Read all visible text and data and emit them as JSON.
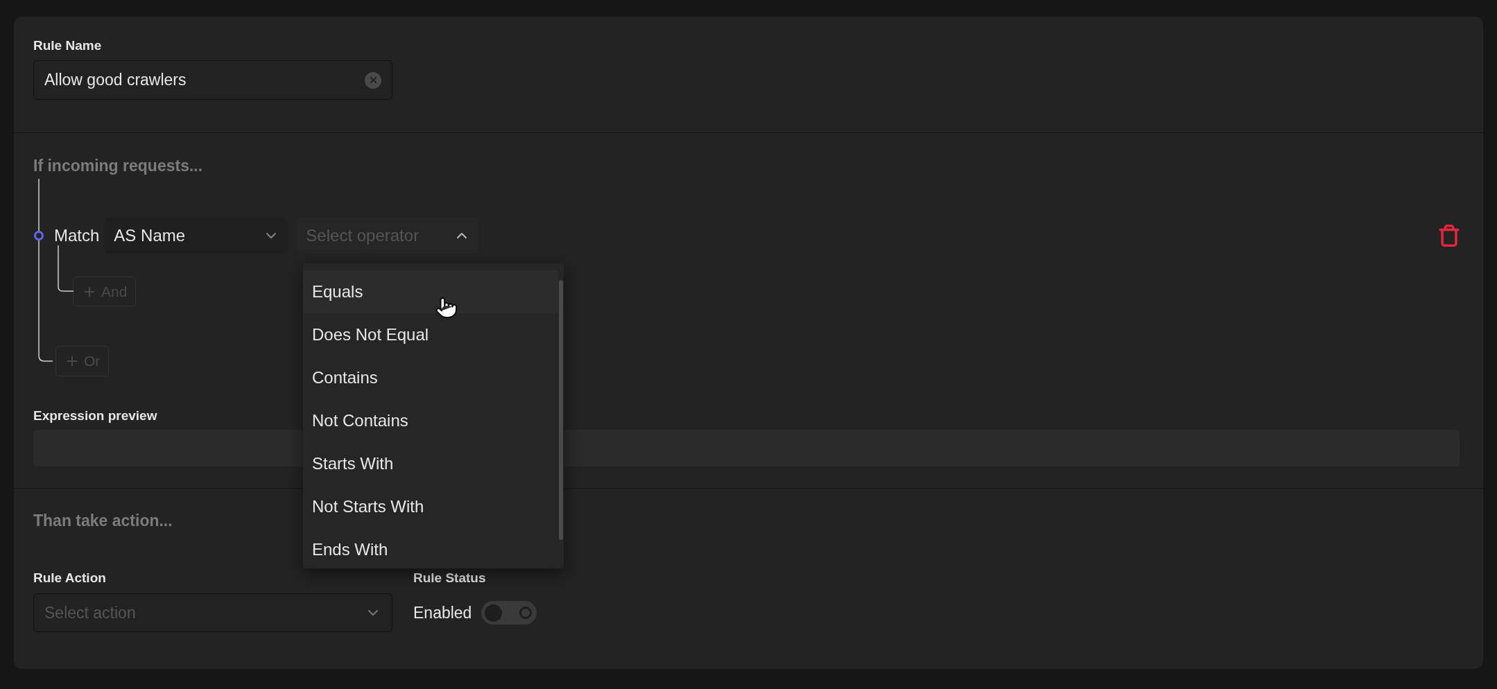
{
  "rule_name": {
    "label": "Rule Name",
    "value": "Allow good crawlers"
  },
  "conditions": {
    "heading": "If incoming requests...",
    "match_label": "Match",
    "field_select": {
      "value": "AS Name"
    },
    "operator_select": {
      "placeholder": "Select operator",
      "expanded": true
    },
    "and_button": "And",
    "or_button": "Or"
  },
  "operator_menu": {
    "items": [
      {
        "label": "Equals",
        "highlighted": true
      },
      {
        "label": "Does Not Equal",
        "highlighted": false
      },
      {
        "label": "Contains",
        "highlighted": false
      },
      {
        "label": "Not Contains",
        "highlighted": false
      },
      {
        "label": "Starts With",
        "highlighted": false
      },
      {
        "label": "Not Starts With",
        "highlighted": false
      },
      {
        "label": "Ends With",
        "highlighted": false
      }
    ]
  },
  "expression_preview": {
    "label": "Expression preview"
  },
  "action": {
    "heading": "Than take action...",
    "rule_action": {
      "label": "Rule Action",
      "placeholder": "Select action"
    },
    "rule_status": {
      "label": "Rule Status",
      "value_label": "Enabled",
      "on": false
    }
  }
}
